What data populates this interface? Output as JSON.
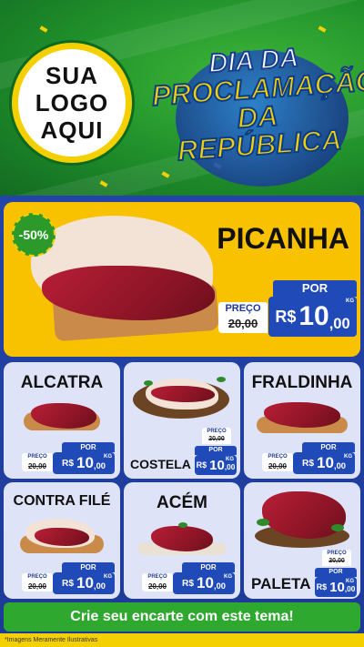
{
  "logo": {
    "line1": "SUA",
    "line2": "LOGO",
    "line3": "AQUI"
  },
  "title": {
    "line1": "DIA DA",
    "line2": "PROCLAMAÇÃO",
    "line3": "DA REPÚBLICA"
  },
  "labels": {
    "preco": "PREÇO",
    "por": "POR",
    "currency": "R$",
    "unit": "KG"
  },
  "hero": {
    "discount": "-50%",
    "name": "PICANHA",
    "old_price": "20,00",
    "new_int": "10",
    "new_cents": ",00"
  },
  "products": [
    {
      "name": "ALCATRA",
      "old_price": "20,00",
      "new_int": "10",
      "new_cents": ",00"
    },
    {
      "name": "COSTELA",
      "old_price": "20,00",
      "new_int": "10",
      "new_cents": ",00"
    },
    {
      "name": "FRALDINHA",
      "old_price": "20,00",
      "new_int": "10",
      "new_cents": ",00"
    },
    {
      "name": "CONTRA FILÉ",
      "old_price": "20,00",
      "new_int": "10",
      "new_cents": ",00"
    },
    {
      "name": "ACÉM",
      "old_price": "20,00",
      "new_int": "10",
      "new_cents": ",00"
    },
    {
      "name": "PALETA",
      "old_price": "20,00",
      "new_int": "10",
      "new_cents": ",00"
    }
  ],
  "cta": "Crie seu encarte com este tema!",
  "footnote": "*Imagens Meramente Ilustrativas",
  "colors": {
    "green": "#2fa830",
    "yellow": "#f8c200",
    "blue": "#1f4ab8",
    "navy": "#1d3a98"
  }
}
